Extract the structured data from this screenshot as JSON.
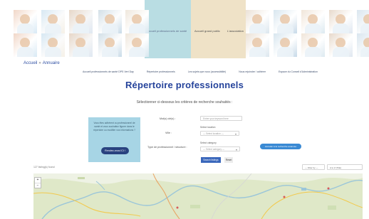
{
  "header": {
    "links": [
      "Accueil professionnels de santé",
      "Accueil grand public",
      "L'association"
    ]
  },
  "breadcrumb": {
    "home": "Accueil",
    "sep": "»",
    "current": "Annuaire"
  },
  "nav": [
    "Accueil professionnels de santé DPS Vert Day",
    "Répertoire professionnels",
    "Les sujets que nous (accessibilité)",
    "Nous rejoindre / adhérer",
    "Espace du Conseil d'Administration"
  ],
  "page": {
    "title": "Répertoire professionnels",
    "subtitle": "Sélectionner ci-dessous les critères de recherche souhaités :"
  },
  "promo": {
    "text": "Vous êtes adhérent ou professionnel de santé et vous souhaitez figurer dans le répertoire ou modifier vos informations ?",
    "button": "Rendez-vous ICI !"
  },
  "search": {
    "name_label": "Mot(s) clé(s) :",
    "name_placeholder": "Entrer your keyword here",
    "location_label": "Ville :",
    "location_hint": "Select location",
    "location_placeholder": "— Select location —",
    "type_label": "Type de professionnel / structure :",
    "category_hint": "Select category",
    "category_placeholder": "— Select category —",
    "search_button": "Search listings",
    "reset_button": "Reset",
    "map_button": "Accéder à la recherche avancée"
  },
  "results": {
    "count": "127 listing(s) found",
    "filter_label": "— Filter by —",
    "sort_label": "A to Z (Title)"
  },
  "map": {
    "zoom_in": "+",
    "zoom_out": "−"
  },
  "colors": {
    "accent": "#25439b",
    "promo_bg": "#a7d5e5",
    "button": "#29427f",
    "map_land": "#dfe8c8",
    "map_water": "#9bc6d9"
  }
}
